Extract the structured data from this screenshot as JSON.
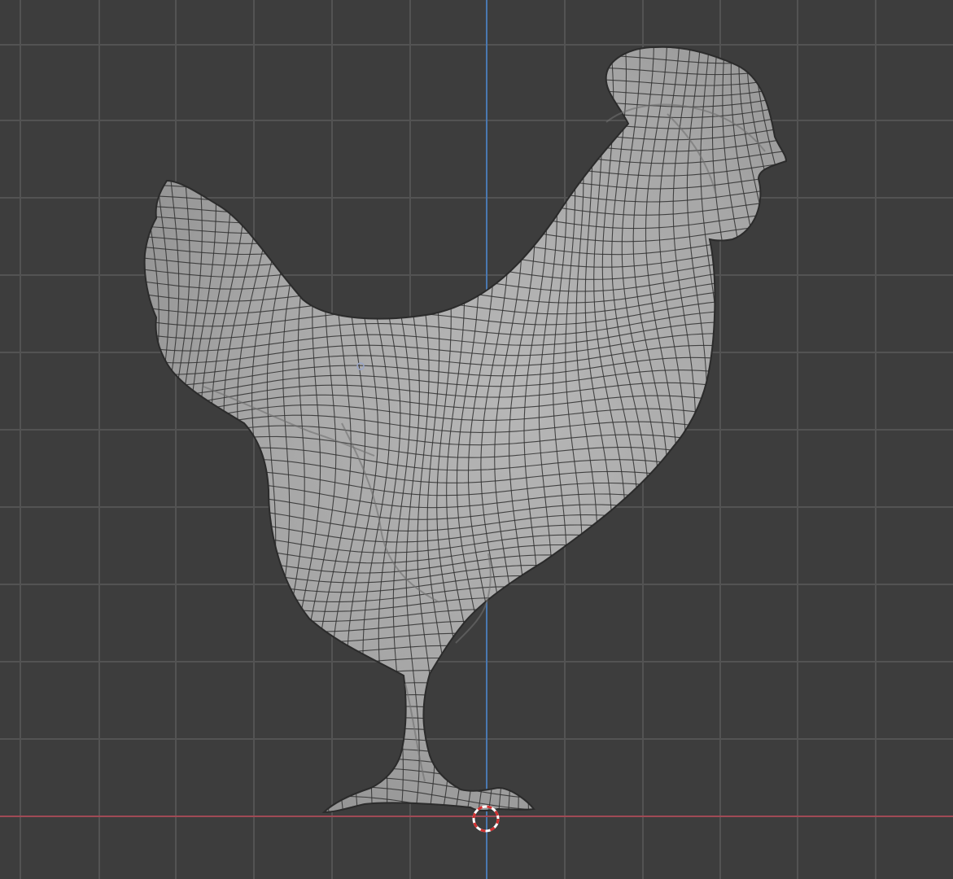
{
  "viewport": {
    "view": "front-orthographic",
    "background_color": "#3d3d3d",
    "grid": {
      "visible": true,
      "line_color": "#535353"
    },
    "axes": {
      "x_axis_color": "#a04a55",
      "z_axis_color": "#4a78b0"
    },
    "object": {
      "subject": "rooster",
      "display_mode": "solid-with-wireframe",
      "mesh_color": "#a9a9a9",
      "wire_color": "#2f2f2f"
    },
    "cursor_3d": {
      "visible": true,
      "ring_colors": [
        "#ffffff",
        "#d23030"
      ]
    },
    "origin_dot": {
      "visible": true,
      "color": "#9aa6c8"
    }
  }
}
